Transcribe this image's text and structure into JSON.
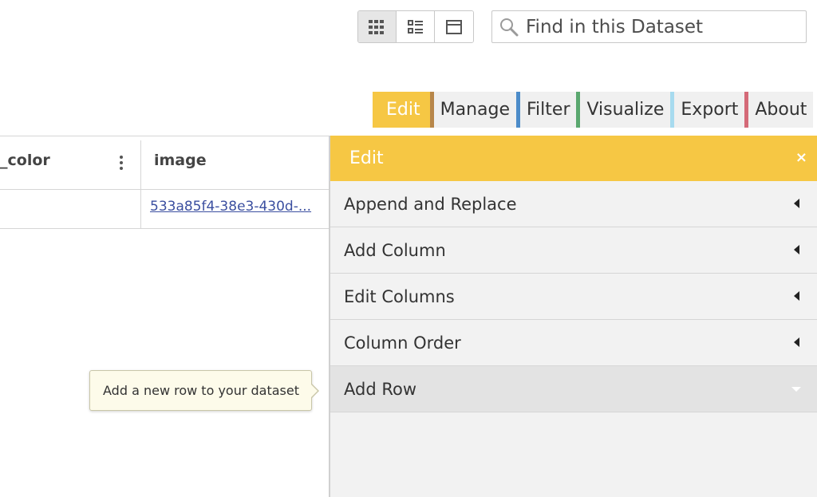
{
  "view_toggles": [
    {
      "icon": "grid-view-icon",
      "active": true
    },
    {
      "icon": "list-view-icon",
      "active": false
    },
    {
      "icon": "card-view-icon",
      "active": false
    }
  ],
  "search": {
    "icon": "search-icon",
    "placeholder": "Find in this Dataset",
    "value": ""
  },
  "tabs": [
    {
      "label": "Edit",
      "color": "#f6c744"
    },
    {
      "label": "Manage",
      "color": "#b7864a"
    },
    {
      "label": "Filter",
      "color": "#4c8cc9"
    },
    {
      "label": "Visualize",
      "color": "#5aa86f"
    },
    {
      "label": "Export",
      "color": "#a7dbef"
    },
    {
      "label": "About",
      "color": "#d46a78"
    }
  ],
  "table": {
    "columns": [
      "_color",
      "image"
    ],
    "rows": [
      {
        "color": "",
        "image": "533a85f4-38e3-430d-..."
      }
    ]
  },
  "panel": {
    "title": "Edit",
    "close_icon": "×",
    "items": [
      {
        "label": "Append and Replace"
      },
      {
        "label": "Add Column"
      },
      {
        "label": "Edit Columns"
      },
      {
        "label": "Column Order"
      },
      {
        "label": "Add Row"
      }
    ]
  },
  "tooltip": {
    "text": "Add a new row to your dataset"
  }
}
